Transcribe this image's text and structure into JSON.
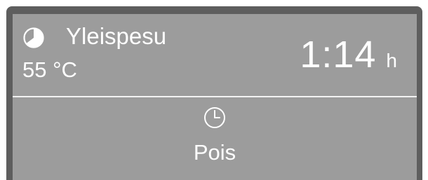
{
  "program": {
    "icon": "program-progress-icon",
    "name": "Yleispesu",
    "temperature": "55 °C"
  },
  "time": {
    "value": "1:14",
    "unit": "h"
  },
  "delay_start": {
    "icon": "clock-icon",
    "label": "Pois"
  },
  "colors": {
    "screen": "#9c9c9c",
    "bezel": "#5e5e5e",
    "text": "#ffffff"
  }
}
